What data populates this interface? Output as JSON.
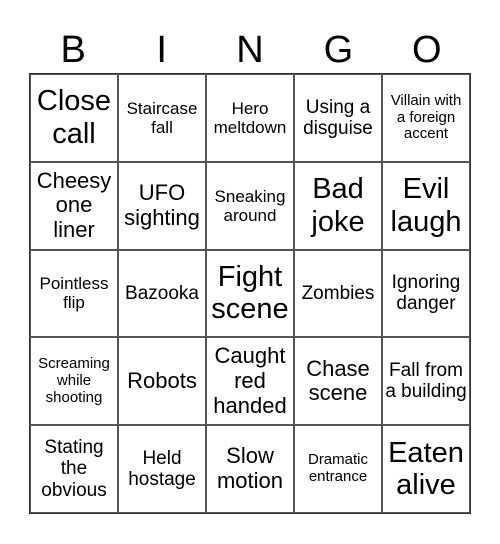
{
  "header": {
    "letters": [
      "B",
      "I",
      "N",
      "G",
      "O"
    ]
  },
  "grid": {
    "rows": [
      [
        "Close call",
        "Staircase fall",
        "Hero meltdown",
        "Using a disguise",
        "Villain with a foreign accent"
      ],
      [
        "Cheesy one liner",
        "UFO sighting",
        "Sneaking around",
        "Bad joke",
        "Evil laugh"
      ],
      [
        "Pointless flip",
        "Bazooka",
        "Fight scene",
        "Zombies",
        "Ignoring danger"
      ],
      [
        "Screaming while shooting",
        "Robots",
        "Caught red handed",
        "Chase scene",
        "Fall from a building"
      ],
      [
        "Stating the obvious",
        "Held hostage",
        "Slow motion",
        "Dramatic entrance",
        "Eaten alive"
      ]
    ]
  }
}
